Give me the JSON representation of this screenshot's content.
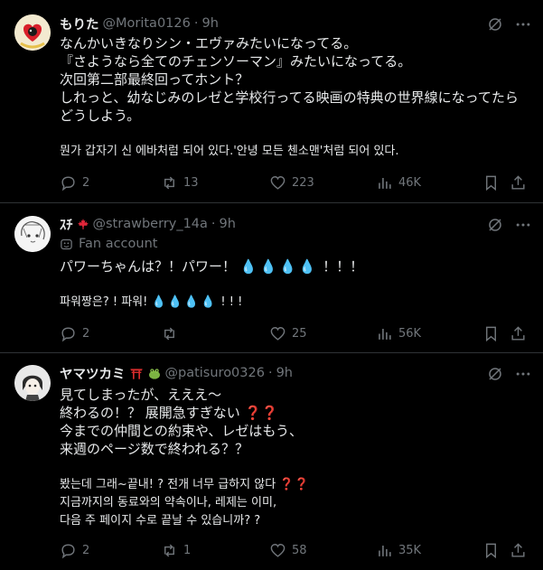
{
  "tweets": [
    {
      "name": "もりた",
      "handle": "@Morita0126",
      "time": "9h",
      "lines": [
        "なんかいきなりシン・エヴァみたいになってる。",
        "『さようなら全てのチェンソーマン』みたいになってる。",
        "次回第二部最終回ってホント？",
        "しれっと、幼なじみのレゼと学校行ってる映画の特典の世界線になってたら",
        "どうしよう。"
      ],
      "translation": [
        "뭔가 갑자기 신 에바처럼 되어 있다.'안녕 모든 첸소맨'처럼 되어 있다."
      ],
      "stats": {
        "replies": "2",
        "reposts": "13",
        "likes": "223",
        "views": "46K"
      }
    },
    {
      "name": "ｽﾁ",
      "badge_icon": "maple-leaf-icon",
      "handle": "@strawberry_14a",
      "time": "9h",
      "fan_label": "Fan account",
      "lines": [
        "パワーちゃんは？！パワー！",
        "！！！"
      ],
      "translation_text": "파워짱은? ! 파워!",
      "translation_tail": "! ! !",
      "stats": {
        "replies": "2",
        "reposts": "",
        "likes": "25",
        "views": "56K"
      }
    },
    {
      "name": "ヤマツカミ",
      "handle": "@patisuro0326",
      "time": "9h",
      "lines": [
        "見てしまったが、えええ〜",
        "終わるの！？ 展開急すぎない",
        "今までの仲間との約束や、レゼはもう、",
        "来週のページ数で終われる？？"
      ],
      "translation": [
        "봤는데 그래~끝내! ? 전개 너무 급하지 않다",
        "지금까지의 동료와의 약속이나, 레제는 이미,",
        "다음 주 페이지 수로 끝날 수 있습니까? ?"
      ],
      "stats": {
        "replies": "2",
        "reposts": "1",
        "likes": "58",
        "views": "35K"
      }
    }
  ],
  "colors": {
    "background": "#000000",
    "text": "#e7e9ea",
    "muted": "#71767b",
    "border": "#2f3336",
    "accent_red": "#e0245e"
  }
}
